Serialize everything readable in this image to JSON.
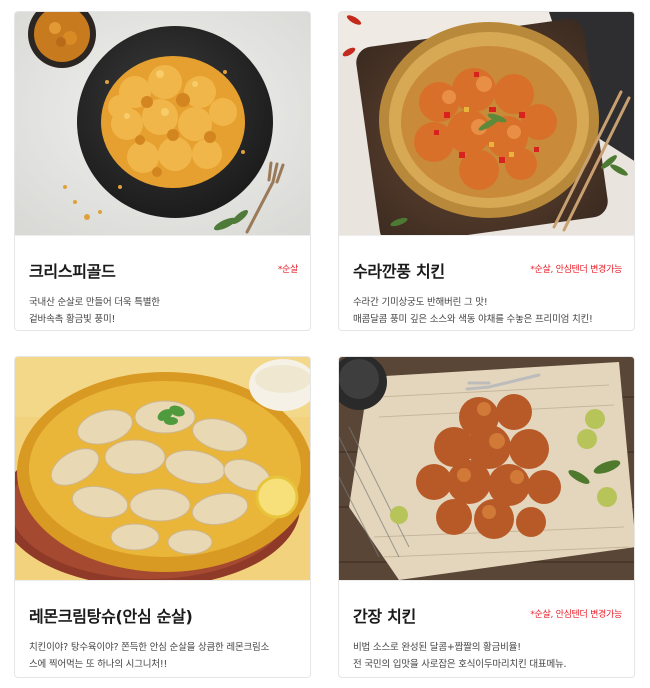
{
  "menu_items": [
    {
      "name": "크리스피골드",
      "tag": "*순살",
      "desc": [
        "국내산 순살로 만들어 더욱 특별한",
        "겉바속촉 황금빛 풍미!"
      ]
    },
    {
      "name": "수라깐풍 치킨",
      "tag": "*순살, 안심텐더 변경가능",
      "desc": [
        "수라간 기미상궁도 반해버린 그 맛!",
        "매콤달콤 풍미 깊은 소스와 색동 야채를 수놓은 프리미엄 치킨!"
      ]
    },
    {
      "name": "레몬크림탕슈(안심 순살)",
      "tag": "",
      "desc": [
        "치킨이야? 탕수육이야? 쫀득한 안심 순살을 상큼한 레몬크림소",
        "스에 찍어먹는 또 하나의 시그니처!!"
      ]
    },
    {
      "name": "간장 치킨",
      "tag": "*순살, 안심텐더 변경가능",
      "desc": [
        "비법 소스로 완성된 달콤+짭짤의 황금비율!",
        "전 국민의 입맛을 사로잡은 호식이두마리치킨 대표메뉴."
      ]
    }
  ],
  "colors": {
    "accent_red": "#e8202a",
    "card_border": "#e6e6e6"
  }
}
